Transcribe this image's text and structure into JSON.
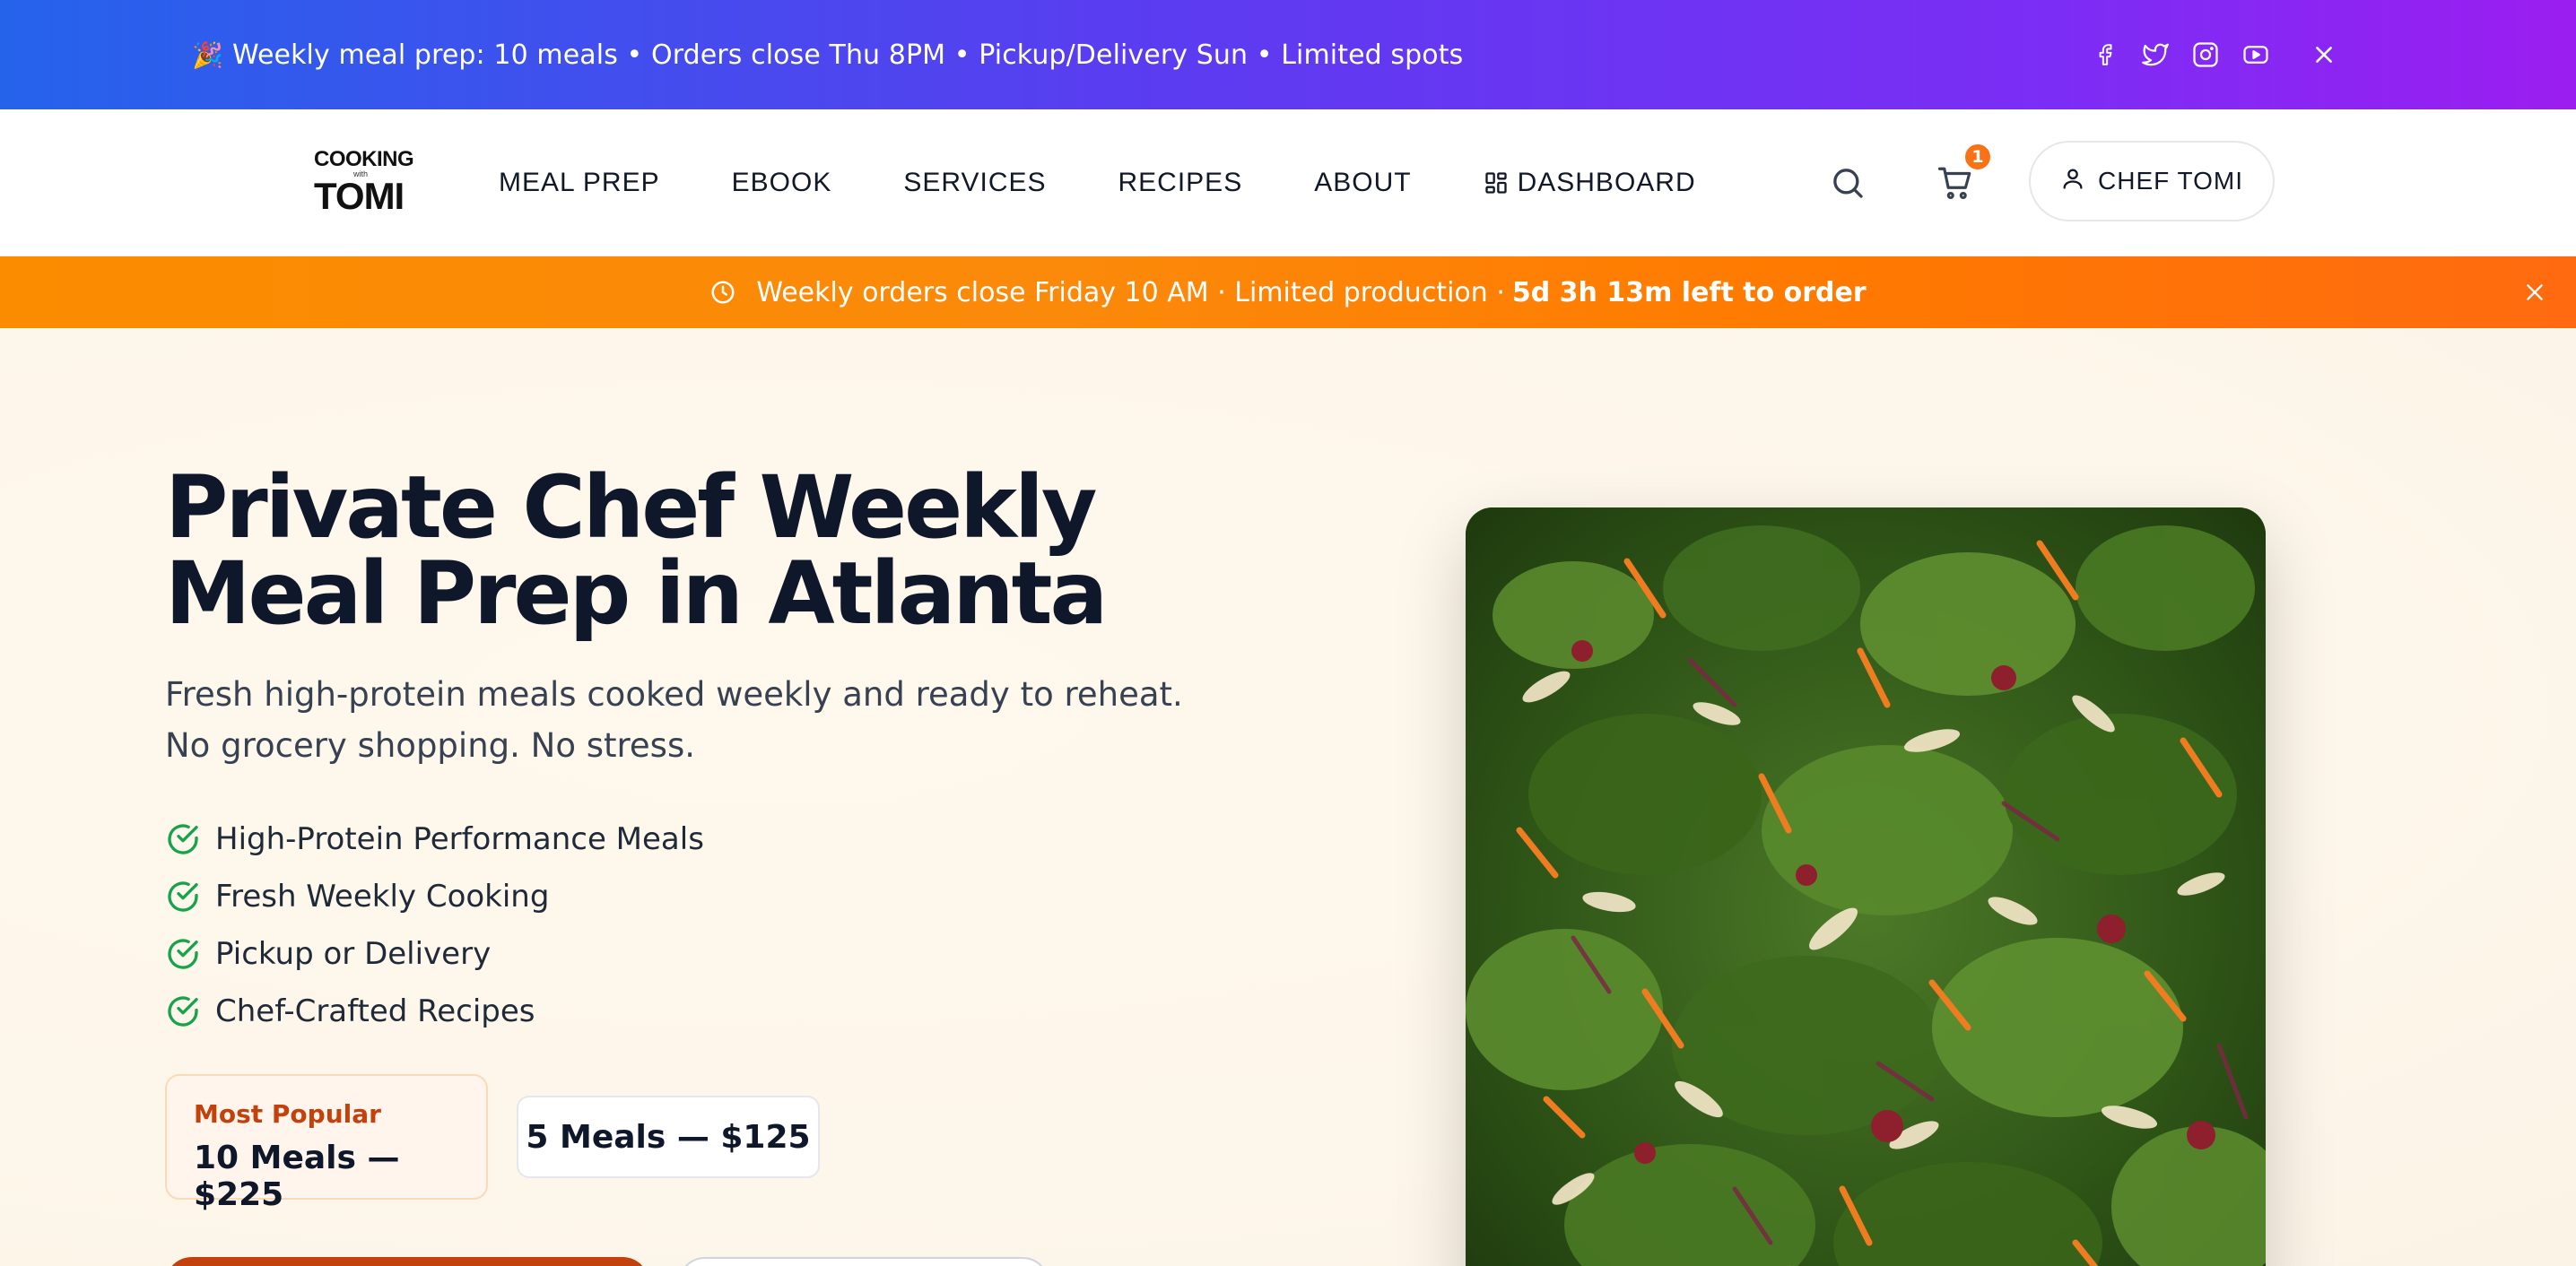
{
  "promo": {
    "emoji": "🎉",
    "text": "Weekly meal prep: 10 meals • Orders close Thu 8PM • Pickup/Delivery Sun • Limited spots",
    "social": [
      "facebook-icon",
      "twitter-icon",
      "instagram-icon",
      "youtube-icon"
    ]
  },
  "header": {
    "logo": {
      "line1": "COOKING",
      "line2": "with",
      "line3": "TOMI"
    },
    "nav": [
      {
        "label": "MEAL PREP"
      },
      {
        "label": "EBOOK"
      },
      {
        "label": "SERVICES"
      },
      {
        "label": "RECIPES"
      },
      {
        "label": "ABOUT"
      },
      {
        "label": "DASHBOARD"
      }
    ],
    "cart_count": "1",
    "user_label": "CHEF TOMI"
  },
  "countdown": {
    "text": "Weekly orders close Friday 10 AM · Limited production ·",
    "emphasis": "5d 3h 13m left to order"
  },
  "hero": {
    "title_line1": "Private Chef Weekly",
    "title_line2": "Meal Prep in Atlanta",
    "subtitle_line1": "Fresh high-protein meals cooked weekly and ready to reheat.",
    "subtitle_line2": "No grocery shopping. No stress.",
    "features": [
      "High-Protein Performance Meals",
      "Fresh Weekly Cooking",
      "Pickup or Delivery",
      "Chef-Crafted Recipes"
    ],
    "plan_popular": {
      "tag": "Most Popular",
      "price": "10 Meals — $225"
    },
    "plan_basic": {
      "price": "5 Meals — $125"
    }
  },
  "colors": {
    "promo_start": "#2563eb",
    "promo_end": "#9b1ef0",
    "countdown": "#fb8c00",
    "accent": "#f97316",
    "check": "#16a34a",
    "hero_bg": "#fdf6ec"
  }
}
